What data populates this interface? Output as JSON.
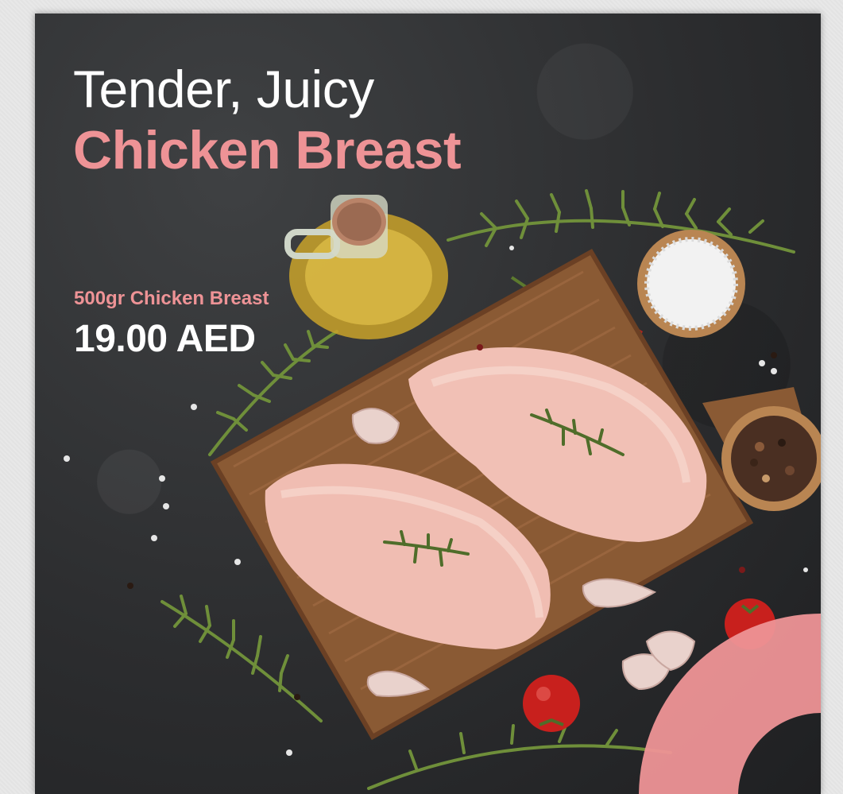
{
  "ad": {
    "headline_line1": "Tender, Juicy",
    "headline_line2": "Chicken Breast",
    "product_name": "500gr Chicken Breast",
    "price": "19.00 AED"
  },
  "colors": {
    "accent_pink": "#ee9396",
    "background": "#2c2d2f",
    "text_white": "#ffffff"
  }
}
